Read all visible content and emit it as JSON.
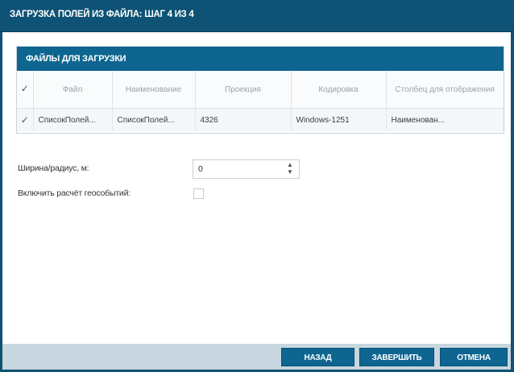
{
  "dialog": {
    "title": "ЗАГРУЗКА ПОЛЕЙ ИЗ ФАЙЛА: ШАГ 4 ИЗ 4"
  },
  "files_panel": {
    "header": "ФАЙЛЫ ДЛЯ ЗАГРУЗКИ",
    "columns": [
      "Файл",
      "Наименование",
      "Проекция",
      "Кодировка",
      "Столбец для отображения"
    ],
    "rows": [
      {
        "checked": true,
        "file": "СписокПолей...",
        "name": "СписокПолей...",
        "projection": "4326",
        "encoding": "Windows-1251",
        "display_column": "Наименован..."
      }
    ]
  },
  "form": {
    "width_label": "Ширина/радиус, м:",
    "width_value": "0",
    "geoevents_label": "Включить расчёт геособытий:",
    "geoevents_checked": false
  },
  "buttons": {
    "back": "НАЗАД",
    "finish": "ЗАВЕРШИТЬ",
    "cancel": "ОТМЕНА"
  },
  "icons": {
    "checkmark": "check-icon",
    "spinner": "spinner-arrows-icon"
  },
  "colors": {
    "titlebar": "#0e5275",
    "accent": "#0e6690",
    "footer": "#c7d6df"
  }
}
